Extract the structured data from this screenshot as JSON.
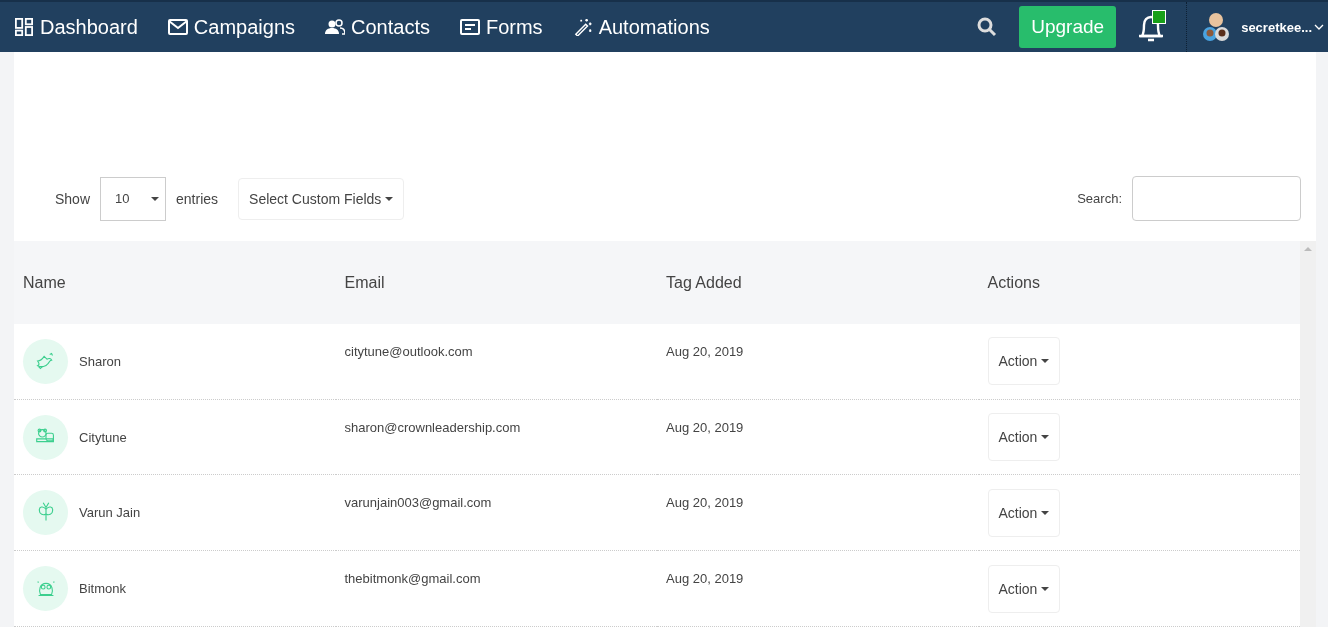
{
  "nav": {
    "items": [
      {
        "label": "Dashboard"
      },
      {
        "label": "Campaigns"
      },
      {
        "label": "Contacts"
      },
      {
        "label": "Forms"
      },
      {
        "label": "Automations"
      }
    ],
    "upgrade": "Upgrade",
    "notification_badge": true,
    "user": "secretkee..."
  },
  "controls": {
    "show": "Show",
    "page_size": "10",
    "entries": "entries",
    "custom_fields": "Select Custom Fields",
    "search_label": "Search:"
  },
  "table": {
    "columns": [
      "Name",
      "Email",
      "Tag Added",
      "Actions"
    ],
    "rows": [
      {
        "name": "Sharon",
        "email": "citytune@outlook.com",
        "tag_added": "Aug 20, 2019",
        "action": "Action"
      },
      {
        "name": "Citytune",
        "email": "sharon@crownleadership.com",
        "tag_added": "Aug 20, 2019",
        "action": "Action"
      },
      {
        "name": "Varun Jain",
        "email": "varunjain003@gmail.com",
        "tag_added": "Aug 20, 2019",
        "action": "Action"
      },
      {
        "name": "Bitmonk",
        "email": "thebitmonk@gmail.com",
        "tag_added": "Aug 20, 2019",
        "action": "Action"
      }
    ]
  }
}
